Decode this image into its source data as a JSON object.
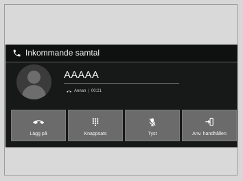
{
  "header": {
    "title": "Inkommande samtal",
    "icon": "phone-icon"
  },
  "caller": {
    "name": "AAAAA",
    "label": "Annan",
    "separator": "|",
    "duration": "00:21",
    "status_icon": "call-status-icon"
  },
  "buttons": [
    {
      "label": "Lägg på",
      "icon": "hang-up-icon"
    },
    {
      "label": "Knappsats",
      "icon": "keypad-icon"
    },
    {
      "label": "Tyst",
      "icon": "mute-icon"
    },
    {
      "label": "Anv. handhållen",
      "icon": "handheld-icon"
    }
  ],
  "colors": {
    "page_background": "#d7d7d7",
    "screen_background": "#171818",
    "button_background": "#6b6b6b",
    "text": "#f4f4f4"
  }
}
